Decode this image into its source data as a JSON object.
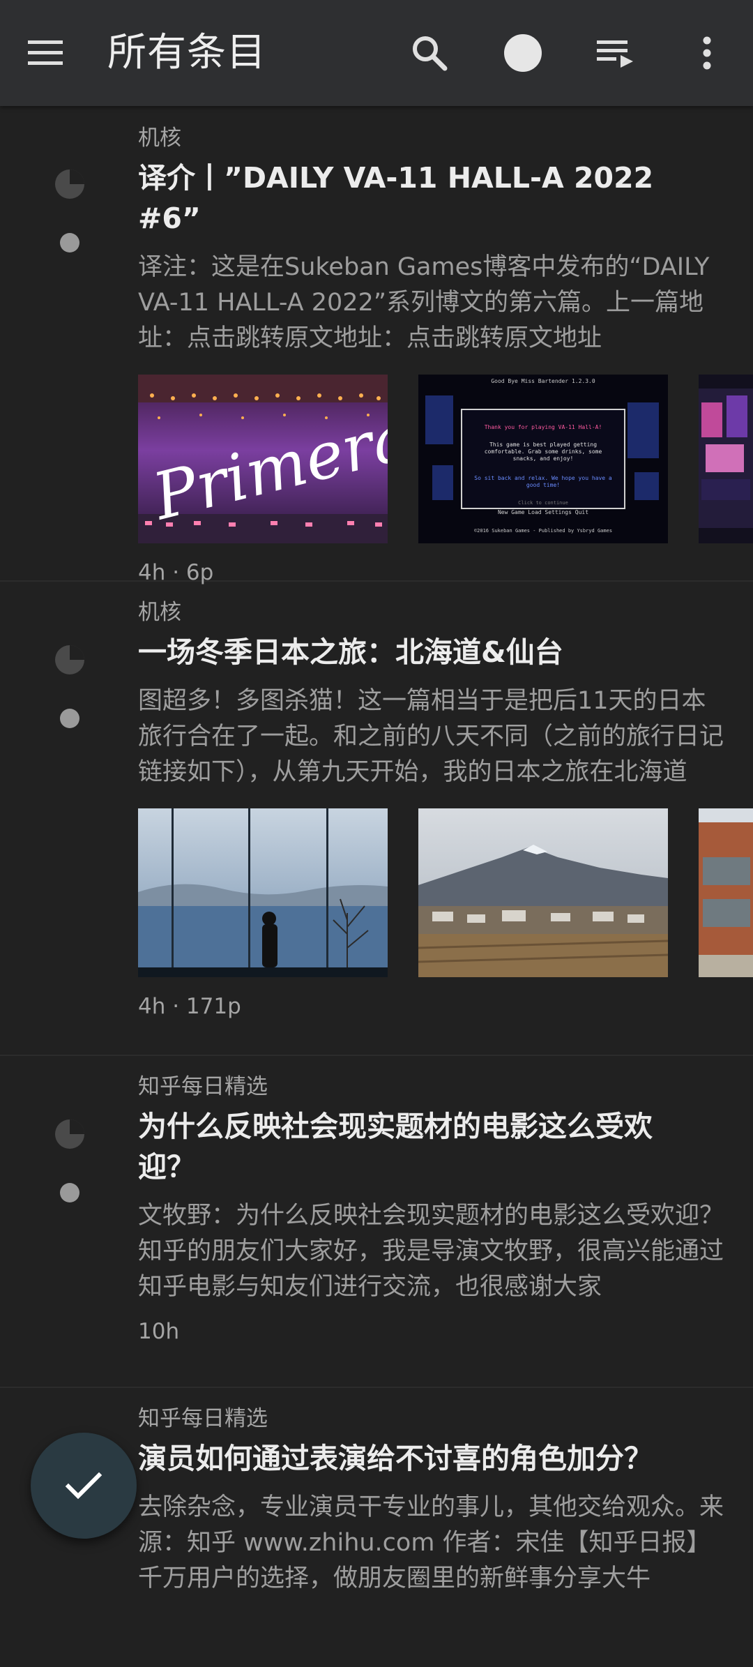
{
  "appbar": {
    "title": "所有条目",
    "icons": [
      "menu-icon",
      "search-icon",
      "circle-filter-icon",
      "playlist-play-icon",
      "more-vert-icon"
    ]
  },
  "articles": [
    {
      "feed": "机核",
      "title": "译介丨”DAILY VA-11 HALL-A 2022 #6”",
      "summary": "译注：这是在Sukeban Games博客中发布的“DAILY VA-11 HALL-A 2022”系列博文的第六篇。上一篇地址：点击跳转原文地址：点击跳转原文地址",
      "meta": "4h · 6p",
      "thumb_text": {
        "primera": "Primera",
        "game_title": "Good Bye Miss Bartender 1.2.3.0",
        "game_msg1": "Thank you for playing VA-11 Hall-A!",
        "game_msg2": "This game is best played getting comfortable. Grab some drinks, some snacks, and enjoy!",
        "game_msg3": "So sit back and relax. We hope you have a good time!",
        "game_click": "Click to continue",
        "game_menu": "New Game   Load   Settings   Quit",
        "game_footer": "©2016 Sukeban Games - Published by Ysbryd Games"
      }
    },
    {
      "feed": "机核",
      "title": "一场冬季日本之旅：北海道&仙台",
      "summary": "图超多！多图杀猫！这一篇相当于是把后11天的日本旅行合在了一起。和之前的八天不同（之前的旅行日记链接如下），从第九天开始，我的日本之旅在北海道",
      "meta": "4h · 171p"
    },
    {
      "feed": "知乎每日精选",
      "title": "为什么反映社会现实题材的电影这么受欢迎？",
      "summary": "文牧野：为什么反映社会现实题材的电影这么受欢迎？知乎的朋友们大家好，我是导演文牧野，很高兴能通过知乎电影与知友们进行交流，也很感谢大家",
      "meta": "10h"
    },
    {
      "feed": "知乎每日精选",
      "title": "演员如何通过表演给不讨喜的角色加分？",
      "summary": "去除杂念，专业演员干专业的事儿，其他交给观众。来源：知乎 www.zhihu.com 作者：宋佳【知乎日报】千万用户的选择，做朋友圈里的新鲜事分享大牛",
      "meta": ""
    }
  ],
  "fab": {
    "icon": "check-icon"
  }
}
